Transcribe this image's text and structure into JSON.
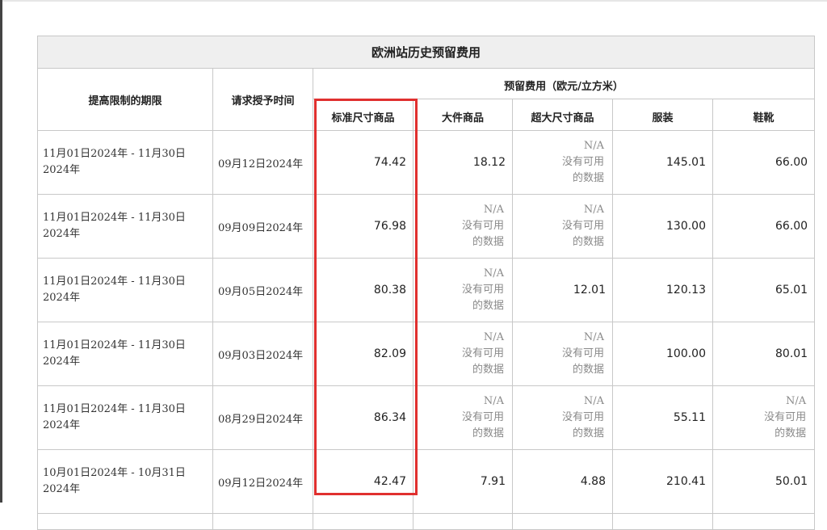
{
  "table": {
    "title": "欧洲站历史预留费用",
    "headers": {
      "period": "提高限制的期限",
      "request_date": "请求授予时间",
      "group": "预留费用（欧元/立方米）",
      "categories": [
        "标准尺寸商品",
        "大件商品",
        "超大尺寸商品",
        "服装",
        "鞋靴"
      ]
    },
    "na_text": {
      "line1": "N/A",
      "line2": "没有可用",
      "line3": "的数据"
    },
    "rows": [
      {
        "period_line1": "11月01日2024年 - 11月30日",
        "period_line2": "2024年",
        "request_date": "09月12日2024年",
        "standard": "74.42",
        "large": "18.12",
        "oversize": "N/A",
        "apparel": "145.01",
        "footwear": "66.00"
      },
      {
        "period_line1": "11月01日2024年 - 11月30日",
        "period_line2": "2024年",
        "request_date": "09月09日2024年",
        "standard": "76.98",
        "large": "N/A",
        "oversize": "N/A",
        "apparel": "130.00",
        "footwear": "66.00"
      },
      {
        "period_line1": "11月01日2024年 - 11月30日",
        "period_line2": "2024年",
        "request_date": "09月05日2024年",
        "standard": "80.38",
        "large": "N/A",
        "oversize": "12.01",
        "apparel": "120.13",
        "footwear": "65.01"
      },
      {
        "period_line1": "11月01日2024年 - 11月30日",
        "period_line2": "2024年",
        "request_date": "09月03日2024年",
        "standard": "82.09",
        "large": "N/A",
        "oversize": "N/A",
        "apparel": "100.00",
        "footwear": "80.01"
      },
      {
        "period_line1": "11月01日2024年 - 11月30日",
        "period_line2": "2024年",
        "request_date": "08月29日2024年",
        "standard": "86.34",
        "large": "N/A",
        "oversize": "N/A",
        "apparel": "55.11",
        "footwear": "N/A"
      },
      {
        "period_line1": "10月01日2024年 - 10月31日",
        "period_line2": "2024年",
        "request_date": "09月12日2024年",
        "standard": "42.47",
        "large": "7.91",
        "oversize": "4.88",
        "apparel": "210.41",
        "footwear": "50.01"
      }
    ]
  },
  "colors": {
    "highlight_border": "#e0302f",
    "title_background": "#efefef",
    "na_text": "#8a8a8a"
  }
}
